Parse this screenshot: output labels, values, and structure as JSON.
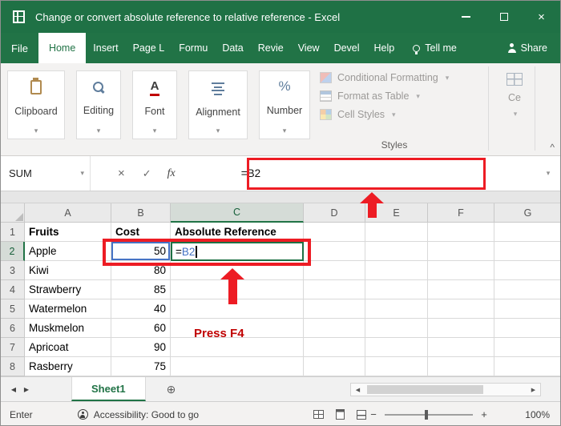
{
  "window": {
    "title": "Change or convert absolute reference to relative reference  -  Excel"
  },
  "icons": {
    "close": "×",
    "cancel": "×",
    "check": "✓",
    "fx": "fx",
    "chevron_down": "▾",
    "dropdown": "▾",
    "nav_left": "◀",
    "nav_right": "▶",
    "plus_circle": "⊕",
    "zoom_minus": "−",
    "zoom_plus": "+",
    "collapse_ribbon": "^"
  },
  "ribbon": {
    "tabs": [
      {
        "label": "File"
      },
      {
        "label": "Home"
      },
      {
        "label": "Insert"
      },
      {
        "label": "Page L"
      },
      {
        "label": "Formu"
      },
      {
        "label": "Data"
      },
      {
        "label": "Revie"
      },
      {
        "label": "View"
      },
      {
        "label": "Devel"
      },
      {
        "label": "Help"
      }
    ],
    "tell_me": "Tell me",
    "share": "Share",
    "groups": [
      {
        "label": "Clipboard"
      },
      {
        "label": "Editing"
      },
      {
        "label": "Font"
      },
      {
        "label": "Alignment"
      },
      {
        "label": "Number"
      }
    ],
    "styles": {
      "items": [
        {
          "label": "Conditional Formatting"
        },
        {
          "label": "Format as Table"
        },
        {
          "label": "Cell Styles"
        }
      ],
      "caption": "Styles"
    },
    "cells": {
      "label": "Ce"
    }
  },
  "formula_bar": {
    "name_box": "SUM",
    "value": "=B2"
  },
  "grid": {
    "columns": [
      "A",
      "B",
      "C",
      "D",
      "E",
      "F",
      "G"
    ],
    "rows": [
      {
        "num": "1",
        "a": "Fruits",
        "b": "Cost",
        "c": "Absolute Reference"
      },
      {
        "num": "2",
        "a": "Apple",
        "b": "50",
        "c": ""
      },
      {
        "num": "3",
        "a": "Kiwi",
        "b": "80",
        "c": ""
      },
      {
        "num": "4",
        "a": "Strawberry",
        "b": "85",
        "c": ""
      },
      {
        "num": "5",
        "a": "Watermelon",
        "b": "40",
        "c": ""
      },
      {
        "num": "6",
        "a": "Muskmelon",
        "b": "60",
        "c": ""
      },
      {
        "num": "7",
        "a": "Apricoat",
        "b": "90",
        "c": ""
      },
      {
        "num": "8",
        "a": "Rasberry",
        "b": "75",
        "c": ""
      }
    ],
    "edit_cell": {
      "cell": "C2",
      "prefix": "=",
      "ref": "B2"
    }
  },
  "annotations": {
    "press_f4": "Press F4"
  },
  "sheet_bar": {
    "active_tab": "Sheet1"
  },
  "status_bar": {
    "mode": "Enter",
    "accessibility": "Accessibility: Good to go",
    "zoom": "100%"
  },
  "colors": {
    "excel_green": "#217346",
    "annotation_red": "#ed1c24",
    "reference_blue": "#4472c4"
  }
}
